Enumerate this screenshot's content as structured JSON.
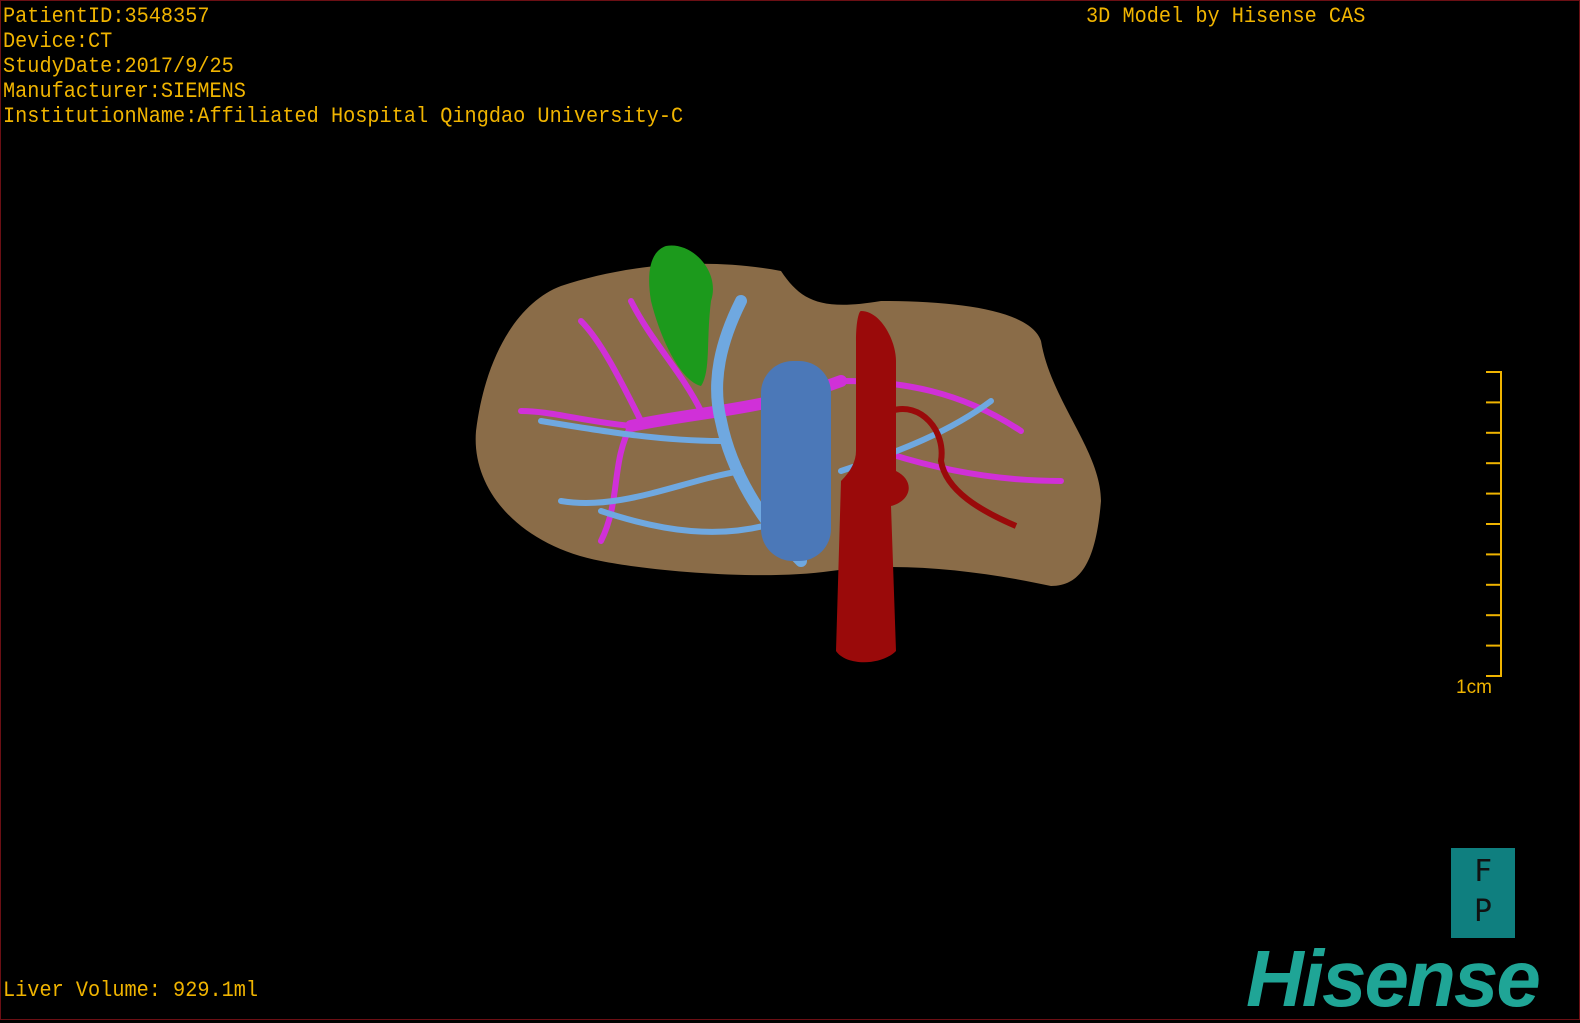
{
  "info": {
    "patient_id": "PatientID:3548357",
    "device": "Device:CT",
    "study_date": "StudyDate:2017/9/25",
    "manufacturer": "Manufacturer:SIEMENS",
    "institution": "InstitutionName:Affiliated Hospital Qingdao University-C"
  },
  "title": "3D Model by Hisense CAS",
  "scale": {
    "label": "1cm",
    "ticks": 10
  },
  "liver_volume": "Liver Volume: 929.1ml",
  "orientation": {
    "top": "F",
    "bottom": "P"
  },
  "logo": "Hisense",
  "colors": {
    "text": "#f0b400",
    "liver": "#8a6c48",
    "gallbladder": "#1c9a1c",
    "portal_vein": "#6fa8e0",
    "vena_cava": "#4b78b8",
    "hepatic_vein": "#d030d8",
    "artery": "#9a0a0a",
    "brand": "#1fa596"
  }
}
